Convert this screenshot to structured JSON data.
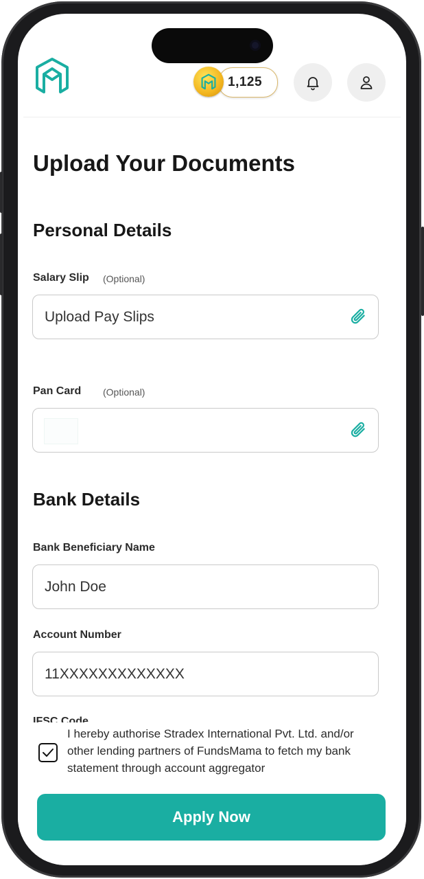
{
  "header": {
    "coin_count": "1,125",
    "brand_color": "#1aaea2",
    "icons": [
      "logo-icon",
      "coin-icon",
      "bell-icon",
      "user-icon"
    ]
  },
  "page_title": "Upload Your Documents",
  "personal_details": {
    "heading": "Personal Details",
    "salary_slip": {
      "label": "Salary Slip",
      "optional": "(Optional)",
      "value": "Upload Pay Slips"
    },
    "pan_card": {
      "label": "Pan Card",
      "optional": "(Optional)",
      "value": ""
    }
  },
  "bank_details": {
    "heading": "Bank Details",
    "beneficiary": {
      "label": "Bank Beneficiary Name",
      "value": "John Doe"
    },
    "account": {
      "label": "Account Number",
      "value": "11XXXXXXXXXXXXX"
    },
    "ifsc": {
      "label": "IFSC Code"
    }
  },
  "consent": {
    "checked": true,
    "text": "I hereby authorise Stradex International Pvt. Ltd. and/or other lending partners of FundsMama to fetch my bank statement through account aggregator"
  },
  "apply_button": {
    "label": "Apply Now"
  }
}
